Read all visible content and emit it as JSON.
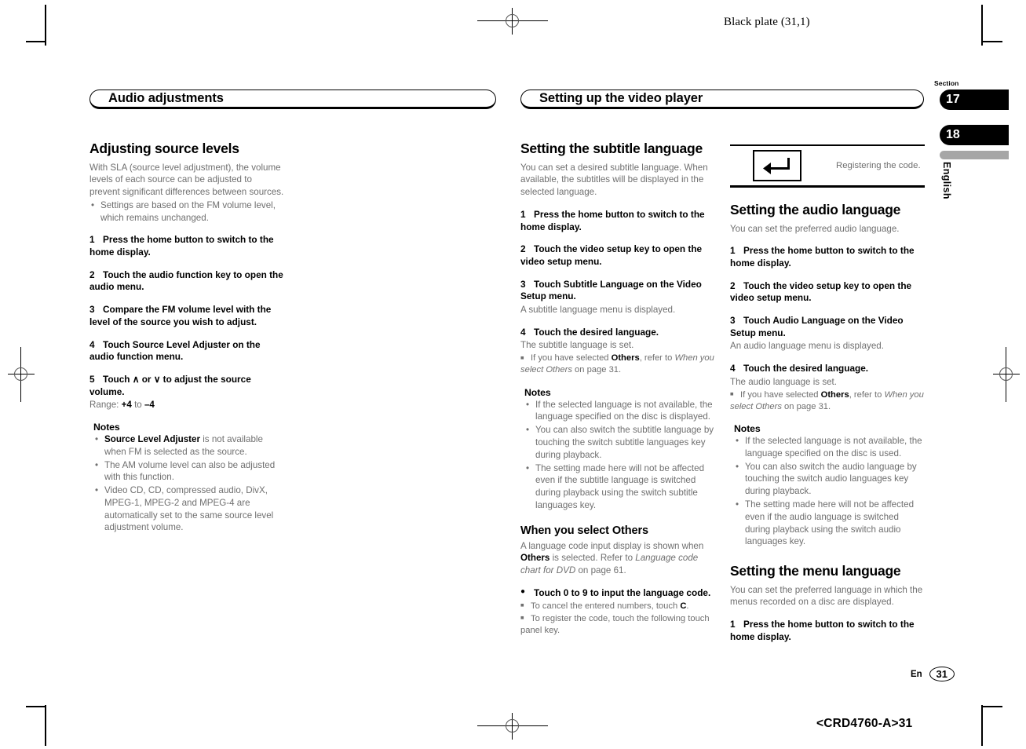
{
  "page": {
    "black_plate": "Black plate (31,1)",
    "footer_code": "<CRD4760-A>31",
    "page_number": "31",
    "lang_code": "En"
  },
  "margin_tabs": {
    "section_label": "Section",
    "tab_17": "17",
    "tab_18": "18",
    "language": "English"
  },
  "chapters": {
    "left_title": "Audio adjustments",
    "mid_title": "Setting up the video player"
  },
  "left_column": {
    "heading": "Adjusting source levels",
    "intro": "With SLA (source level adjustment), the volume levels of each source can be adjusted to prevent significant differences between sources.",
    "intro_bullets": [
      "Settings are based on the FM volume level, which remains unchanged."
    ],
    "steps": [
      {
        "n": "1",
        "text": "Press the home button to switch to the home display."
      },
      {
        "n": "2",
        "text": "Touch the audio function key to open the audio menu."
      },
      {
        "n": "3",
        "text": "Compare the FM volume level with the level of the source you wish to adjust."
      },
      {
        "n": "4",
        "text": "Touch Source Level Adjuster on the audio function menu."
      },
      {
        "n": "5",
        "text": "Touch ∧ or ∨ to adjust the source volume."
      }
    ],
    "range_label": "Range:",
    "range_from": "+4",
    "range_to_word": "to",
    "range_to": "–4",
    "notes_title": "Notes",
    "notes": [
      {
        "bold": "Source Level Adjuster",
        "rest": " is not available when FM is selected as the source."
      },
      {
        "bold": "",
        "rest": "The AM volume level can also be adjusted with this function."
      },
      {
        "bold": "",
        "rest": "Video CD, CD, compressed audio, DivX, MPEG-1, MPEG-2 and MPEG-4 are automatically set to the same source level adjustment volume."
      }
    ]
  },
  "mid_column": {
    "heading": "Setting the subtitle language",
    "intro": "You can set a desired subtitle language. When available, the subtitles will be displayed in the selected language.",
    "steps": [
      {
        "n": "1",
        "text": "Press the home button to switch to the home display."
      },
      {
        "n": "2",
        "text": "Touch the video setup key to open the video setup menu."
      },
      {
        "n": "3",
        "text": "Touch Subtitle Language on the Video Setup menu."
      },
      {
        "n": "4",
        "text": "Touch the desired language."
      }
    ],
    "result_3": "A subtitle language menu is displayed.",
    "result_4": "The subtitle language is set.",
    "square_note_pre": "If you have selected ",
    "square_note_bold": "Others",
    "square_note_mid": ", refer to ",
    "square_note_italic": "When you select Others",
    "square_note_post": " on page 31.",
    "notes_title": "Notes",
    "notes": [
      "If the selected language is not available, the language specified on the disc is displayed.",
      "You can also switch the subtitle language by touching the switch subtitle languages key during playback.",
      "The setting made here will not be affected even if the subtitle language is switched during playback using the switch subtitle languages key."
    ],
    "others_heading": "When you select Others",
    "others_intro_pre": "A language code input display is shown when ",
    "others_intro_bold": "Others",
    "others_intro_mid": " is selected. Refer to ",
    "others_intro_italic": "Language code chart for DVD",
    "others_intro_post": " on page 61.",
    "others_step": "Touch 0 to 9 to input the language code.",
    "others_note_1_pre": "To cancel the entered numbers, touch ",
    "others_note_1_bold": "C",
    "others_note_1_post": ".",
    "others_note_2": "To register the code, touch the following touch panel key."
  },
  "right_column": {
    "figure_caption": "Registering the code.",
    "figure_icon": "enter-return-arrow-icon",
    "audio_heading": "Setting the audio language",
    "audio_intro": "You can set the preferred audio language.",
    "audio_steps": [
      {
        "n": "1",
        "text": "Press the home button to switch to the home display."
      },
      {
        "n": "2",
        "text": "Touch the video setup key to open the video setup menu."
      },
      {
        "n": "3",
        "text": "Touch Audio Language on the Video Setup menu."
      },
      {
        "n": "4",
        "text": "Touch the desired language."
      }
    ],
    "audio_result_3": "An audio language menu is displayed.",
    "audio_result_4": "The audio language is set.",
    "square_note_pre": "If you have selected ",
    "square_note_bold": "Others",
    "square_note_mid": ", refer to ",
    "square_note_italic": "When you select Others",
    "square_note_post": " on page 31.",
    "notes_title": "Notes",
    "notes": [
      "If the selected language is not available, the language specified on the disc is used.",
      "You can also switch the audio language by touching the switch audio languages key during playback.",
      "The setting made here will not be affected even if the audio language is switched during playback using the switch audio languages key."
    ],
    "menu_heading": "Setting the menu language",
    "menu_intro": "You can set the preferred language in which the menus recorded on a disc are displayed.",
    "menu_steps": [
      {
        "n": "1",
        "text": "Press the home button to switch to the home display."
      }
    ]
  },
  "colors": {
    "body_text": "#6f6f6f",
    "heading_text": "#000000",
    "tab_bg": "#000000",
    "gray_bar": "#a6a6a6"
  }
}
